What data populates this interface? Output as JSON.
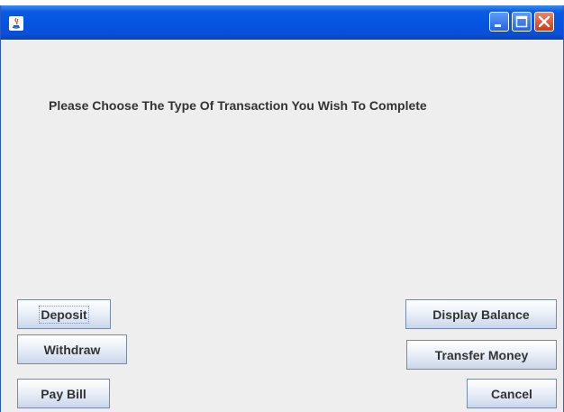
{
  "window": {
    "icon": "java-app-icon",
    "controls": {
      "minimize": "minimize-icon",
      "maximize": "maximize-icon",
      "close": "close-icon"
    },
    "titlebar_color": "#0454e0",
    "close_color": "#cc3c15"
  },
  "prompt": "Please Choose The Type Of Transaction You Wish To Complete",
  "buttons": {
    "deposit": "Deposit",
    "withdraw": "Withdraw",
    "pay_bill": "Pay Bill",
    "display_balance": "Display Balance",
    "transfer_money": "Transfer Money",
    "cancel": "Cancel"
  }
}
